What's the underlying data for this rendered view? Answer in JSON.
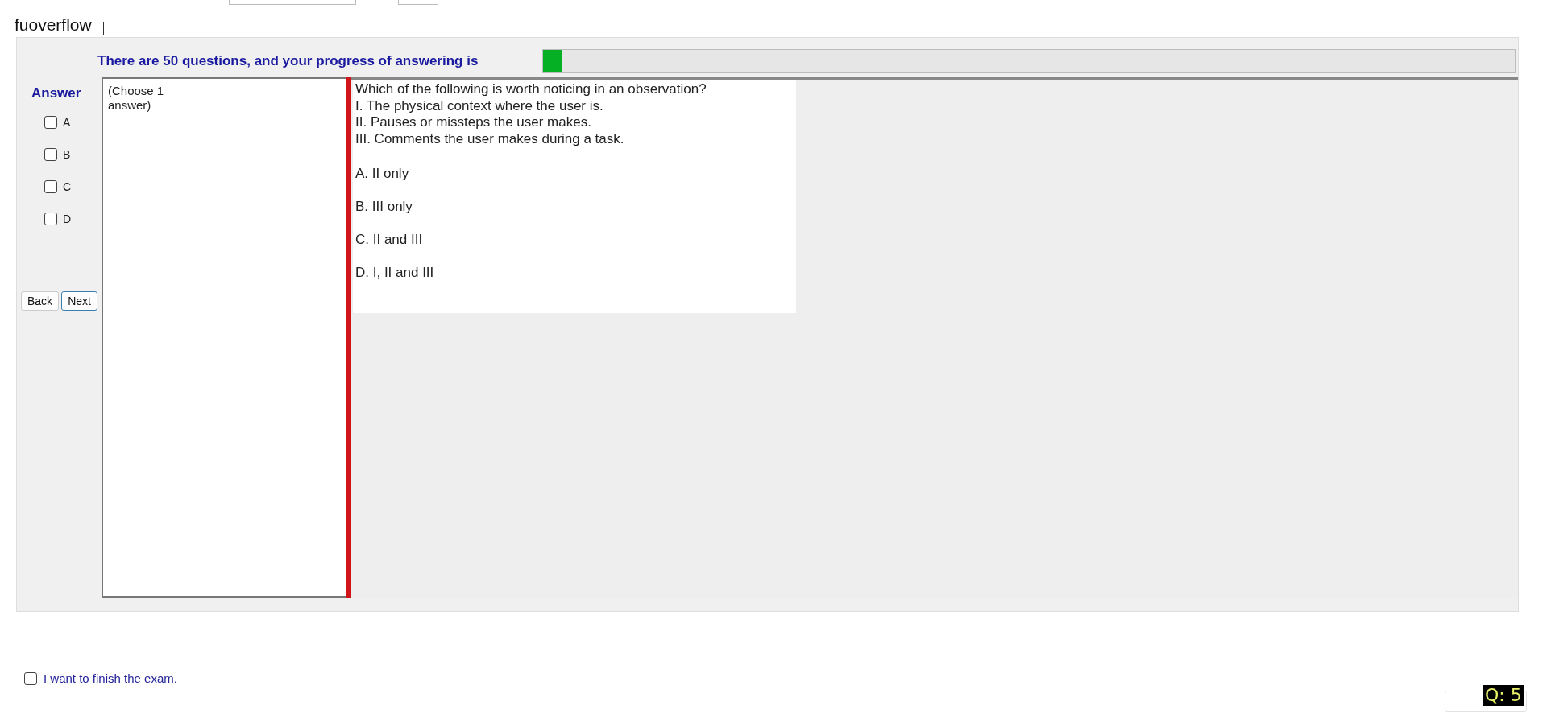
{
  "app_name": "fuoverflow",
  "progress": {
    "label": "There are 50 questions, and your progress of answering is",
    "level": 0.02
  },
  "answer": {
    "title": "Answer",
    "options": [
      {
        "label": "A",
        "checked": false
      },
      {
        "label": "B",
        "checked": false
      },
      {
        "label": "C",
        "checked": false
      },
      {
        "label": "D",
        "checked": false
      }
    ]
  },
  "buttons": [
    {
      "label": "Back",
      "selected": false
    },
    {
      "label": "Next",
      "selected": true
    }
  ],
  "instruction": "(Choose 1 answer)",
  "question": {
    "lines": [
      "Which of the following is worth noticing in an observation?",
      "I. The physical context where the user is.",
      "II. Pauses or missteps the user makes.",
      "III. Comments the user makes during a task."
    ],
    "choices": [
      "A.  II only",
      "B.  III only",
      "C.  II and III",
      "D.  I, II and III"
    ]
  },
  "finish": {
    "label": "I want to finish the exam.",
    "checked": false
  },
  "question_badge": "Q: 5"
}
